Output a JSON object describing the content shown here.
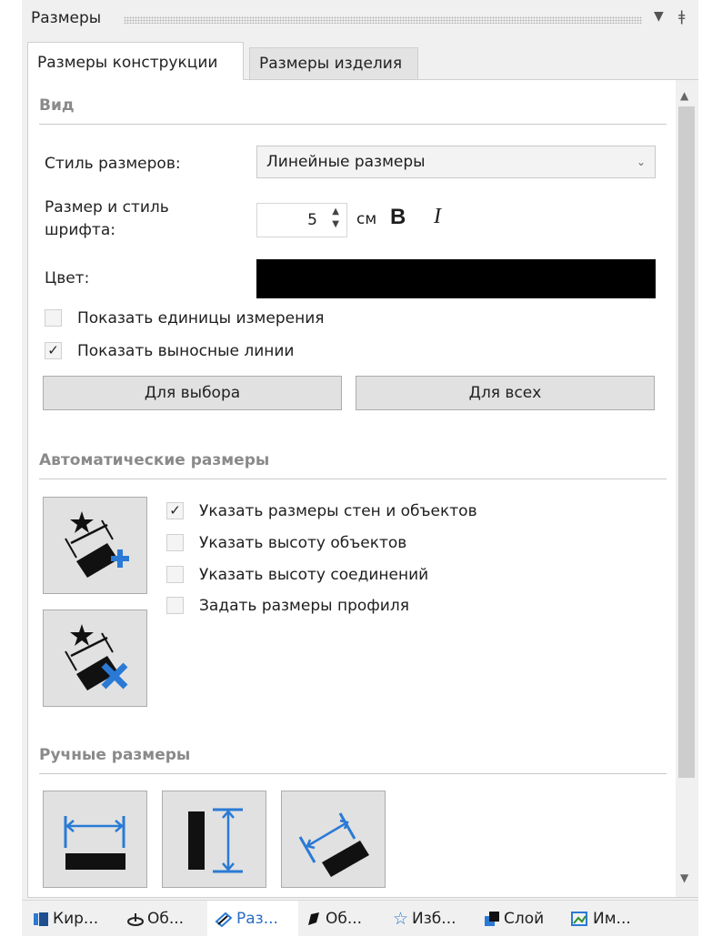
{
  "panel": {
    "title": "Размеры",
    "pin_icon": "pin-icon",
    "menu_icon": "dropdown-icon"
  },
  "tabs": [
    {
      "label": "Размеры конструкции",
      "active": true
    },
    {
      "label": "Размеры изделия",
      "active": false
    }
  ],
  "view": {
    "heading": "Вид",
    "style_label": "Стиль размеров:",
    "style_value": "Линейные размеры",
    "font_label": "Размер и стиль шрифта:",
    "font_size": "5",
    "font_unit": "см",
    "bold_label": "B",
    "italic_label": "I",
    "color_label": "Цвет:",
    "color_value": "#000000",
    "show_units": {
      "label": "Показать единицы измерения",
      "checked": false
    },
    "show_ext_lines": {
      "label": "Показать выносные линии",
      "checked": true
    },
    "for_selection": "Для выбора",
    "for_all": "Для всех"
  },
  "auto": {
    "heading": "Автоматические размеры",
    "options": [
      {
        "label": "Указать размеры стен и объектов",
        "checked": true
      },
      {
        "label": "Указать высоту объектов",
        "checked": false
      },
      {
        "label": "Указать высоту соединений",
        "checked": false
      },
      {
        "label": "Задать размеры профиля",
        "checked": false
      }
    ]
  },
  "manual": {
    "heading": "Ручные размеры"
  },
  "bottom_tabs": [
    {
      "label": "Кир...",
      "icon": "brick-icon"
    },
    {
      "label": "Об...",
      "icon": "object-icon"
    },
    {
      "label": "Раз...",
      "icon": "dimension-icon",
      "active": true
    },
    {
      "label": "Об...",
      "icon": "paint-icon"
    },
    {
      "label": "Изб...",
      "icon": "star-icon"
    },
    {
      "label": "Слой",
      "icon": "layer-icon"
    },
    {
      "label": "Им...",
      "icon": "image-icon"
    }
  ],
  "colors": {
    "accent": "#2b6cc4",
    "icon_blue": "#2a7ad5"
  }
}
